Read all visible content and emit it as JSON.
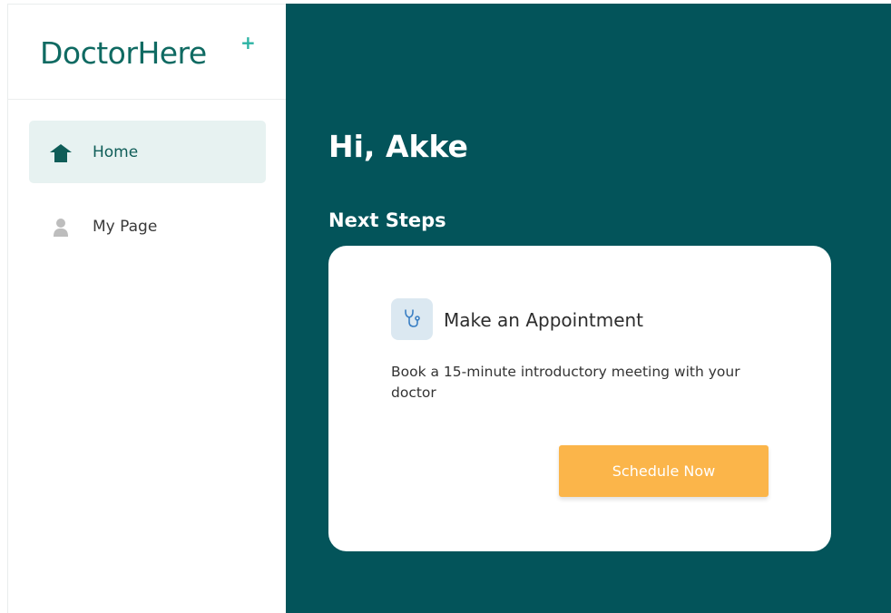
{
  "brand": {
    "name": "DoctorHere",
    "plus_symbol": "+",
    "color": "#0f6a62",
    "accent": "#2bb3a3"
  },
  "sidebar": {
    "items": [
      {
        "label": "Home",
        "icon": "home-icon",
        "active": true
      },
      {
        "label": "My Page",
        "icon": "user-icon",
        "active": false
      }
    ]
  },
  "main": {
    "greeting": "Hi, Akke",
    "section_title": "Next Steps",
    "background": "#03545a",
    "card": {
      "icon": "stethoscope-icon",
      "title": "Make an Appointment",
      "description": "Book a 15-minute introductory meeting with your doctor",
      "button_label": "Schedule Now",
      "button_color": "#fbb54a"
    }
  }
}
